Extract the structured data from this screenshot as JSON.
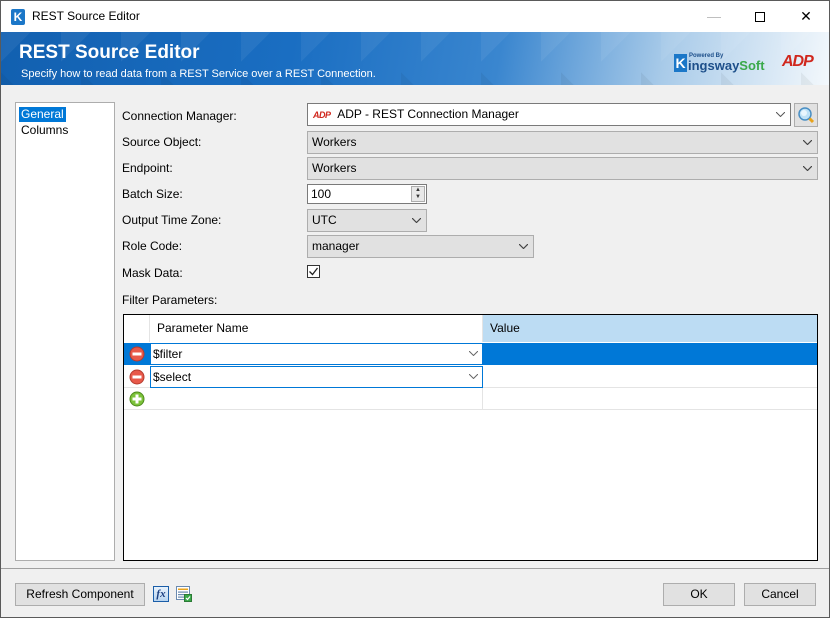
{
  "window": {
    "title": "REST Source Editor",
    "app_icon_letter": "K",
    "controls": {
      "minimize": "—",
      "close": "✕"
    }
  },
  "banner": {
    "title": "REST Source Editor",
    "subtitle": "Specify how to read data from a REST Service over a REST Connection.",
    "brand": {
      "powered_by": "Powered By",
      "k": "K",
      "name_main": "ingsway",
      "name_soft": "Soft"
    },
    "partner_logo": "ADP"
  },
  "nav": {
    "items": [
      {
        "label": "General",
        "active": true
      },
      {
        "label": "Columns",
        "active": false
      }
    ]
  },
  "form": {
    "connection_manager": {
      "label": "Connection Manager:",
      "value": "ADP - REST Connection Manager",
      "icon_text": "ADP"
    },
    "source_object": {
      "label": "Source Object:",
      "value": "Workers"
    },
    "endpoint": {
      "label": "Endpoint:",
      "value": "Workers"
    },
    "batch_size": {
      "label": "Batch Size:",
      "value": "100"
    },
    "output_time_zone": {
      "label": "Output Time Zone:",
      "value": "UTC"
    },
    "role_code": {
      "label": "Role Code:",
      "value": "manager"
    },
    "mask_data": {
      "label": "Mask Data:",
      "checked": true,
      "check_glyph": "✓"
    },
    "filter_parameters": {
      "label": "Filter Parameters:"
    }
  },
  "grid": {
    "columns": [
      "Parameter Name",
      "Value"
    ],
    "rows": [
      {
        "name": "$filter",
        "value": "",
        "selected": true,
        "action": "remove"
      },
      {
        "name": "$select",
        "value": "",
        "selected": false,
        "action": "remove"
      },
      {
        "name": "",
        "value": "",
        "selected": false,
        "action": "add"
      }
    ]
  },
  "footer": {
    "refresh_label": "Refresh Component",
    "fx_label": "fx",
    "ok_label": "OK",
    "cancel_label": "Cancel"
  },
  "colors": {
    "accent": "#0078d7",
    "header_selected": "#bcdcf3",
    "brand_blue": "#1b77c8",
    "adp_red": "#d0271d",
    "brand_green": "#3aa94a"
  }
}
